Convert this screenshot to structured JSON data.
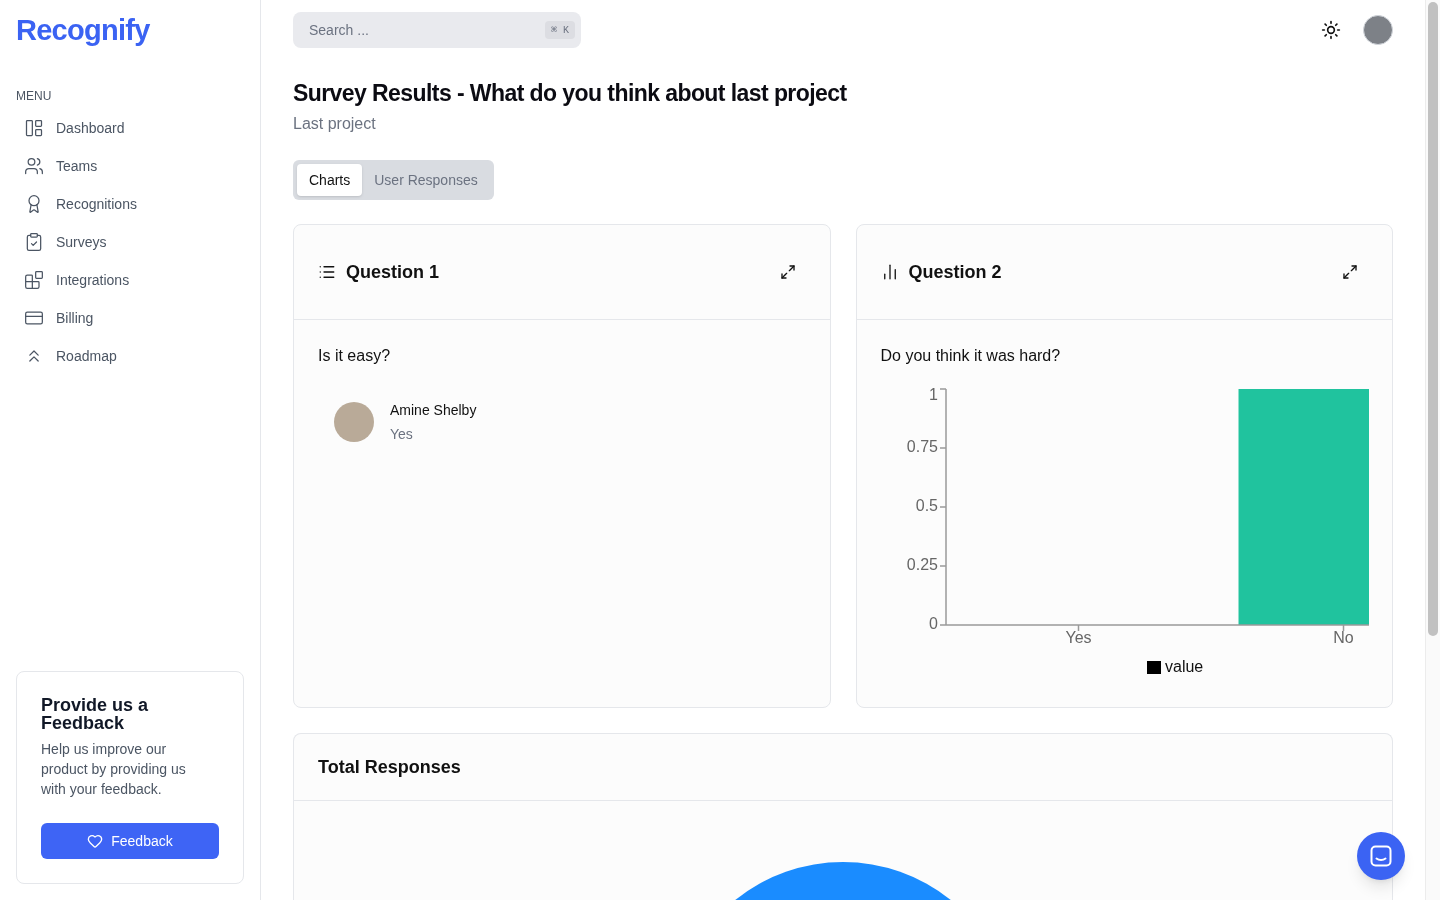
{
  "sidebar": {
    "logo": "Recognify",
    "menu_label": "MENU",
    "items": [
      {
        "label": "Dashboard"
      },
      {
        "label": "Teams"
      },
      {
        "label": "Recognitions"
      },
      {
        "label": "Surveys"
      },
      {
        "label": "Integrations"
      },
      {
        "label": "Billing"
      },
      {
        "label": "Roadmap"
      }
    ]
  },
  "feedback_card": {
    "title": "Provide us a Feedback",
    "text": "Help us improve our product by providing us with your feedback.",
    "button": "Feedback"
  },
  "search": {
    "placeholder": "Search ...",
    "shortcut": "⌘ K"
  },
  "page": {
    "title": "Survey Results - What do you think about last project",
    "subtitle": "Last project"
  },
  "tabs": [
    {
      "label": "Charts",
      "selected": true
    },
    {
      "label": "User Responses",
      "selected": false
    }
  ],
  "questions": [
    {
      "kind": "list",
      "title": "Question 1",
      "question": "Is it easy?",
      "responses": [
        {
          "name": "Amine Shelby",
          "answer": "Yes"
        }
      ]
    },
    {
      "kind": "chart",
      "title": "Question 2",
      "question": "Do you think it was hard?",
      "chart_data": {
        "type": "bar",
        "categories": [
          "Yes",
          "No"
        ],
        "series": [
          {
            "name": "value",
            "color": "#20c39e",
            "values": [
              0,
              1
            ]
          }
        ],
        "ylim": [
          0,
          1
        ],
        "yticks": [
          0,
          0.25,
          0.5,
          0.75,
          1
        ]
      }
    }
  ],
  "total_responses": {
    "title": "Total Responses"
  }
}
